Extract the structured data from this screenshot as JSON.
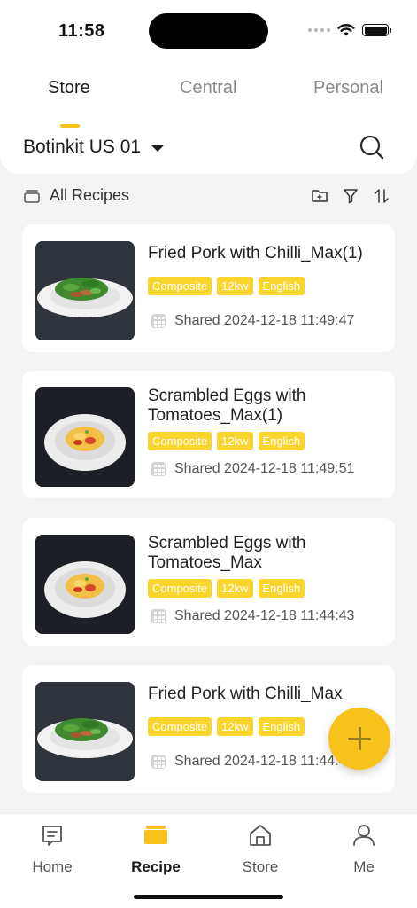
{
  "status_bar": {
    "time": "11:58"
  },
  "tabs": [
    {
      "label": "Store",
      "active": true
    },
    {
      "label": "Central",
      "active": false
    },
    {
      "label": "Personal",
      "active": false
    }
  ],
  "store_selector": {
    "name": "Botinkit US 01"
  },
  "toolbar": {
    "all_recipes_label": "All Recipes"
  },
  "recipes": [
    {
      "title": "Fried Pork with Chilli_Max(1)",
      "tags": [
        "Composite",
        "12kw",
        "English"
      ],
      "shared": "Shared 2024-12-18 11:49:47",
      "image": "fried-pork-dish"
    },
    {
      "title": "Scrambled Eggs with Tomatoes_Max(1)",
      "tags": [
        "Composite",
        "12kw",
        "English"
      ],
      "shared": "Shared 2024-12-18 11:49:51",
      "image": "scrambled-eggs-dish"
    },
    {
      "title": "Scrambled Eggs with Tomatoes_Max",
      "tags": [
        "Composite",
        "12kw",
        "English"
      ],
      "shared": "Shared 2024-12-18 11:44:43",
      "image": "scrambled-eggs-dish"
    },
    {
      "title": "Fried Pork with Chilli_Max",
      "tags": [
        "Composite",
        "12kw",
        "English"
      ],
      "shared": "Shared 2024-12-18 11:44:43",
      "image": "fried-pork-dish"
    }
  ],
  "bottom_nav": [
    {
      "label": "Home",
      "icon": "home-icon",
      "active": false
    },
    {
      "label": "Recipe",
      "icon": "recipe-icon",
      "active": true
    },
    {
      "label": "Store",
      "icon": "store-icon",
      "active": false
    },
    {
      "label": "Me",
      "icon": "person-icon",
      "active": false
    }
  ],
  "colors": {
    "accent": "#f7c21b",
    "tag_bg": "#fad52d",
    "background": "#f4f4f4"
  }
}
